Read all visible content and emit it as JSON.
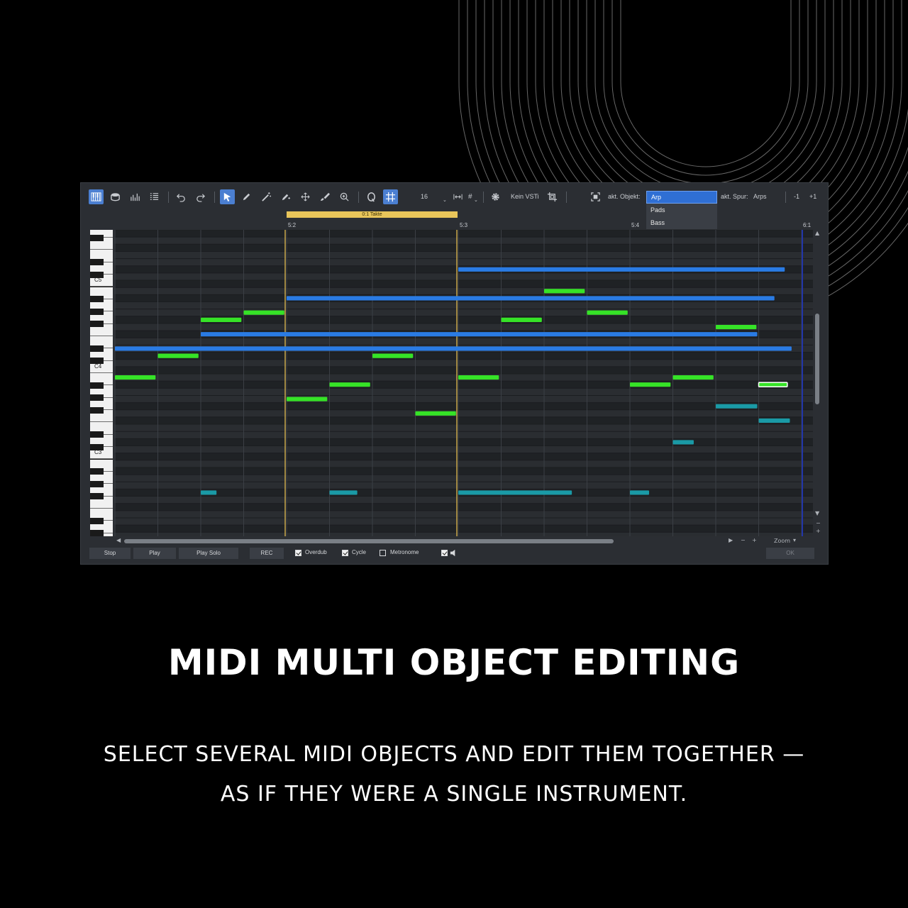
{
  "toolbar": {
    "grid_value": "16",
    "vsti_label": "Kein VSTi",
    "object_label": "akt. Objekt:",
    "object_selected": "Arp",
    "object_options": [
      "Pads",
      "Bass"
    ],
    "track_label": "akt. Spur:",
    "track_value": "Arps",
    "minus_label": "-1",
    "plus_label": "+1"
  },
  "ruler": {
    "loop_label": "0:1 Takte",
    "bars": [
      "5:2",
      "5:3",
      "5:4",
      "6:1"
    ]
  },
  "keyboard": {
    "octave_labels": [
      "C5",
      "C4",
      "C3"
    ]
  },
  "piano_roll": {
    "colors": {
      "melody": "#36e327",
      "chords": "#2a7be4",
      "bass": "#1a9aa6"
    },
    "notes": [
      {
        "lane": "melody",
        "row": 20,
        "start": 0.0,
        "len": 0.245
      },
      {
        "lane": "melody",
        "row": 17,
        "start": 0.25,
        "len": 0.245
      },
      {
        "lane": "melody",
        "row": 12,
        "start": 0.5,
        "len": 0.245
      },
      {
        "lane": "melody",
        "row": 11,
        "start": 0.75,
        "len": 0.245
      },
      {
        "lane": "melody",
        "row": 23,
        "start": 1.0,
        "len": 0.245
      },
      {
        "lane": "melody",
        "row": 21,
        "start": 1.25,
        "len": 0.245
      },
      {
        "lane": "melody",
        "row": 17,
        "start": 1.5,
        "len": 0.245
      },
      {
        "lane": "melody",
        "row": 25,
        "start": 1.75,
        "len": 0.245
      },
      {
        "lane": "melody",
        "row": 20,
        "start": 2.0,
        "len": 0.245
      },
      {
        "lane": "melody",
        "row": 12,
        "start": 2.25,
        "len": 0.245
      },
      {
        "lane": "melody",
        "row": 8,
        "start": 2.5,
        "len": 0.245
      },
      {
        "lane": "melody",
        "row": 11,
        "start": 2.75,
        "len": 0.245
      },
      {
        "lane": "melody",
        "row": 21,
        "start": 3.0,
        "len": 0.245
      },
      {
        "lane": "melody",
        "row": 20,
        "start": 3.25,
        "len": 0.245
      },
      {
        "lane": "melody",
        "row": 13,
        "start": 3.5,
        "len": 0.245
      },
      {
        "lane": "melody",
        "row": 21,
        "start": 3.75,
        "len": 0.175,
        "selected": true
      },
      {
        "lane": "chords",
        "row": 16,
        "start": 0.0,
        "len": 3.95
      },
      {
        "lane": "chords",
        "row": 14,
        "start": 0.5,
        "len": 3.25
      },
      {
        "lane": "chords",
        "row": 9,
        "start": 1.0,
        "len": 2.85
      },
      {
        "lane": "chords",
        "row": 5,
        "start": 2.0,
        "len": 1.91
      },
      {
        "lane": "bass",
        "row": 24,
        "start": 3.5,
        "len": 0.25
      },
      {
        "lane": "bass",
        "row": 26,
        "start": 3.75,
        "len": 0.19
      },
      {
        "lane": "bass",
        "row": 29,
        "start": 3.25,
        "len": 0.13
      },
      {
        "lane": "bass",
        "row": 36,
        "start": 0.5,
        "len": 0.1
      },
      {
        "lane": "bass",
        "row": 36,
        "start": 1.25,
        "len": 0.17
      },
      {
        "lane": "bass",
        "row": 36,
        "start": 2.0,
        "len": 0.67
      },
      {
        "lane": "bass",
        "row": 36,
        "start": 3.0,
        "len": 0.12
      }
    ]
  },
  "scroll": {
    "zoom_label": "Zoom"
  },
  "transport": {
    "stop": "Stop",
    "play": "Play",
    "play_solo": "Play Solo",
    "rec": "REC",
    "overdub": "Overdub",
    "cycle": "Cycle",
    "metronome": "Metronome",
    "ok": "OK"
  },
  "caption": {
    "headline": "MIDI MULTI OBJECT EDITING",
    "subline_1": "SELECT SEVERAL MIDI OBJECTS AND EDIT THEM TOGETHER —",
    "subline_2": "AS IF THEY WERE A SINGLE INSTRUMENT."
  }
}
